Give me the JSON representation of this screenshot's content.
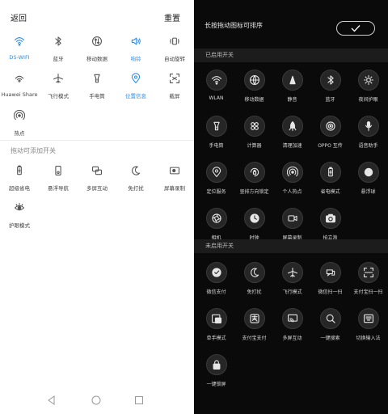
{
  "left": {
    "back_label": "返回",
    "reset_label": "重置",
    "active_tiles": [
      {
        "label": "DS-WIFI",
        "icon": "wifi-icon",
        "on": true
      },
      {
        "label": "蓝牙",
        "icon": "bluetooth-icon",
        "on": false
      },
      {
        "label": "移动数据",
        "icon": "mobile-data-icon",
        "on": false
      },
      {
        "label": "响铃",
        "icon": "sound-icon",
        "on": true
      },
      {
        "label": "自动旋转",
        "icon": "auto-rotate-icon",
        "on": false
      },
      {
        "label": "Huawei Share",
        "icon": "huawei-share-icon",
        "on": false
      },
      {
        "label": "飞行模式",
        "icon": "airplane-icon",
        "on": false
      },
      {
        "label": "手电筒",
        "icon": "flashlight-icon",
        "on": false
      },
      {
        "label": "位置信息",
        "icon": "location-icon",
        "on": true
      },
      {
        "label": "截屏",
        "icon": "screenshot-icon",
        "on": false
      },
      {
        "label": "热点",
        "icon": "hotspot-icon",
        "on": false
      }
    ],
    "addable_section_title": "拖动可添加开关",
    "addable_tiles": [
      {
        "label": "超级省电",
        "icon": "battery-icon"
      },
      {
        "label": "悬浮导航",
        "icon": "float-nav-icon"
      },
      {
        "label": "多屏互动",
        "icon": "multi-screen-icon"
      },
      {
        "label": "免打扰",
        "icon": "moon-icon"
      },
      {
        "label": "屏幕录制",
        "icon": "screen-record-icon"
      },
      {
        "label": "护眼模式",
        "icon": "eye-icon"
      }
    ]
  },
  "right": {
    "title": "长按拖动图标可排序",
    "enabled_section_title": "已启用开关",
    "enabled_tiles": [
      {
        "label": "WLAN",
        "icon": "wifi-icon"
      },
      {
        "label": "移动数据",
        "icon": "globe-icon"
      },
      {
        "label": "静音",
        "icon": "mute-icon"
      },
      {
        "label": "蓝牙",
        "icon": "bluetooth-icon"
      },
      {
        "label": "夜间护眼",
        "icon": "night-eye-icon"
      },
      {
        "label": "手电筒",
        "icon": "flashlight-icon"
      },
      {
        "label": "计算器",
        "icon": "calculator-icon"
      },
      {
        "label": "清理加速",
        "icon": "rocket-icon"
      },
      {
        "label": "OPPO 互传",
        "icon": "oppo-share-icon"
      },
      {
        "label": "语音助手",
        "icon": "microphone-icon"
      },
      {
        "label": "定位服务",
        "icon": "location-icon"
      },
      {
        "label": "竖排方向锁定",
        "icon": "rotation-lock-icon"
      },
      {
        "label": "个人热点",
        "icon": "hotspot-icon"
      },
      {
        "label": "省电模式",
        "icon": "battery-icon"
      },
      {
        "label": "悬浮球",
        "icon": "float-ball-icon"
      },
      {
        "label": "相机",
        "icon": "camera-aperture-icon"
      },
      {
        "label": "时钟",
        "icon": "clock-icon"
      },
      {
        "label": "屏幕录制",
        "icon": "video-icon"
      },
      {
        "label": "拍立淘",
        "icon": "camera-icon"
      }
    ],
    "disabled_section_title": "未启用开关",
    "disabled_tiles": [
      {
        "label": "微信支付",
        "icon": "wechat-pay-icon"
      },
      {
        "label": "免打扰",
        "icon": "moon-icon"
      },
      {
        "label": "飞行模式",
        "icon": "airplane-icon"
      },
      {
        "label": "微信扫一扫",
        "icon": "wechat-scan-icon"
      },
      {
        "label": "支付宝扫一扫",
        "icon": "alipay-scan-icon"
      },
      {
        "label": "单手模式",
        "icon": "one-hand-icon"
      },
      {
        "label": "支付宝支付",
        "icon": "alipay-icon"
      },
      {
        "label": "多屏互动",
        "icon": "cast-icon"
      },
      {
        "label": "一键搜索",
        "icon": "search-icon"
      },
      {
        "label": "切换输入法",
        "icon": "keyboard-icon"
      },
      {
        "label": "一键锁屏",
        "icon": "lock-icon"
      }
    ]
  },
  "colors": {
    "accent_blue": "#2a8ce8",
    "left_bg": "#ffffff",
    "right_bg": "#0a0a0a"
  }
}
